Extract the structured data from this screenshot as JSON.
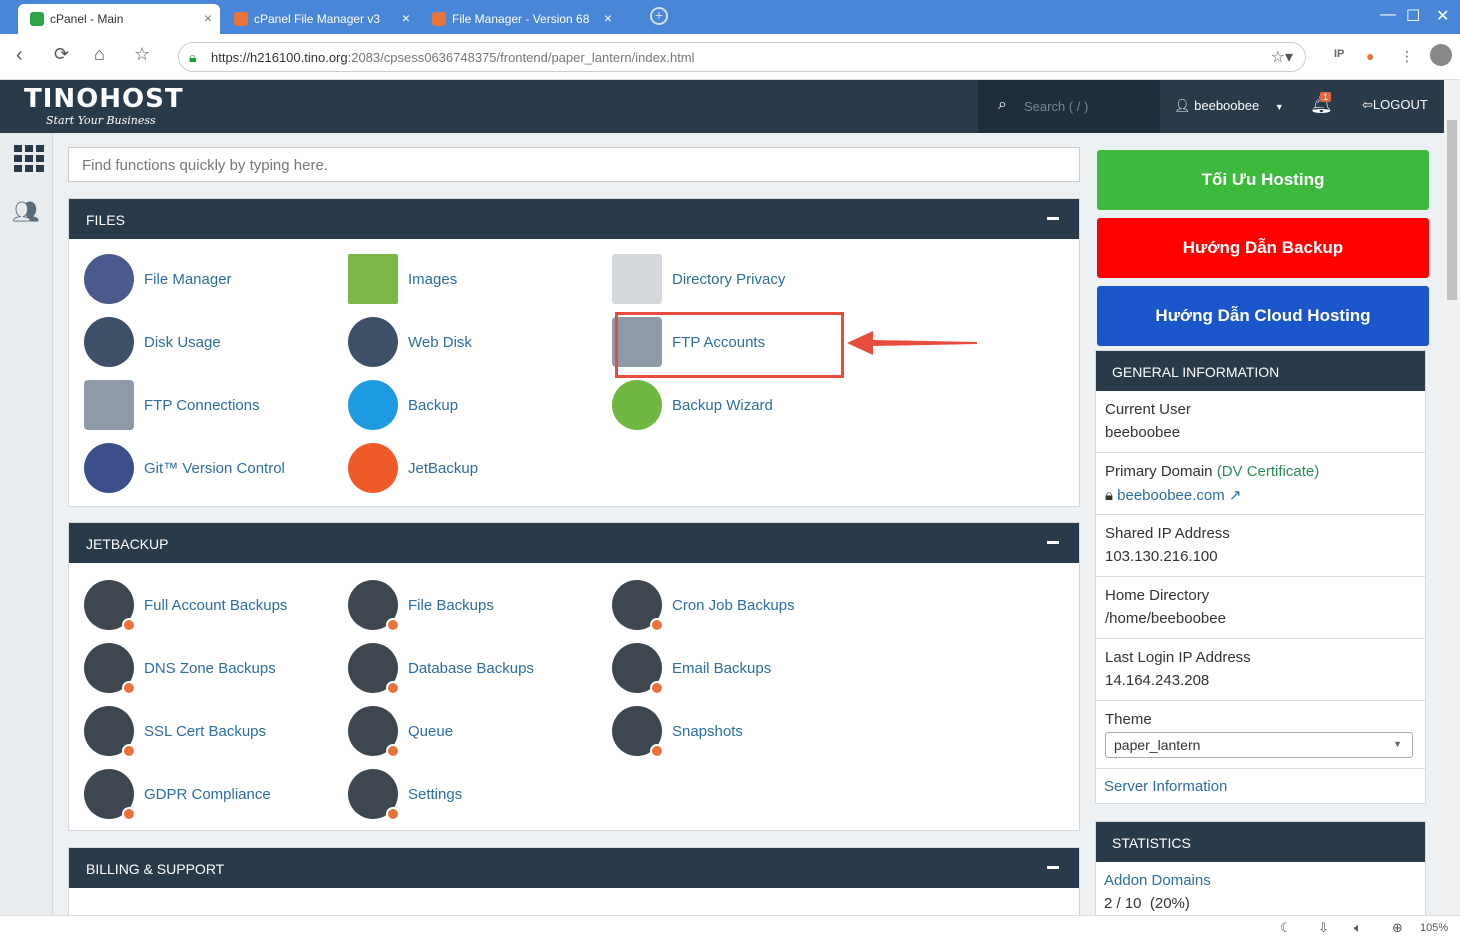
{
  "browser": {
    "tabs": [
      {
        "title": "cPanel - Main",
        "active": true
      },
      {
        "title": "cPanel File Manager v3",
        "active": false
      },
      {
        "title": "File Manager - Version 68",
        "active": false
      }
    ],
    "url_host": "https://h216100.tino.org",
    "url_rest": ":2083/cpsess0636748375/frontend/paper_lantern/index.html",
    "zoom": "105%"
  },
  "header": {
    "logo": "TINOHOST",
    "logo_tagline": "Start Your Business",
    "search_placeholder": "Search ( / )",
    "username": "beeboobee",
    "notifications": "1",
    "logout": "LOGOUT"
  },
  "quick_search_placeholder": "Find functions quickly by typing here.",
  "sections": {
    "files": {
      "title": "FILES",
      "items": [
        "File Manager",
        "Images",
        "Directory Privacy",
        "Disk Usage",
        "Web Disk",
        "FTP Accounts",
        "FTP Connections",
        "Backup",
        "Backup Wizard",
        "Git™ Version Control",
        "JetBackup"
      ]
    },
    "jetbackup": {
      "title": "JETBACKUP",
      "items": [
        "Full Account Backups",
        "File Backups",
        "Cron Job Backups",
        "DNS Zone Backups",
        "Database Backups",
        "Email Backups",
        "SSL Cert Backups",
        "Queue",
        "Snapshots",
        "GDPR Compliance",
        "Settings"
      ]
    },
    "billing": {
      "title": "BILLING & SUPPORT"
    }
  },
  "promo": {
    "btn1": "Tối Ưu Hosting",
    "btn2": "Hướng Dẫn Backup",
    "btn3": "Hướng Dẫn Cloud Hosting",
    "colors": {
      "btn1": "#3dba3d",
      "btn2": "#ff0000",
      "btn3": "#1a56c9"
    }
  },
  "general_info": {
    "title": "GENERAL INFORMATION",
    "current_user_label": "Current User",
    "current_user": "beeboobee",
    "primary_domain_label": "Primary Domain",
    "primary_domain_cert": "(DV Certificate)",
    "primary_domain": "beeboobee.com",
    "shared_ip_label": "Shared IP Address",
    "shared_ip": "103.130.216.100",
    "home_dir_label": "Home Directory",
    "home_dir": "/home/beeboobee",
    "last_login_label": "Last Login IP Address",
    "last_login": "14.164.243.208",
    "theme_label": "Theme",
    "theme": "paper_lantern",
    "server_info": "Server Information"
  },
  "statistics": {
    "title": "STATISTICS",
    "addon_label": "Addon Domains",
    "addon_value": "2 / 10",
    "addon_pct": "(20%)"
  }
}
